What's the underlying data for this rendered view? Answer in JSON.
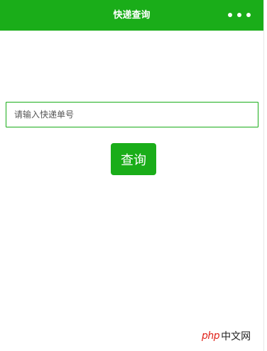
{
  "navbar": {
    "title": "快递查询",
    "background_color": "#1aad19",
    "menu_icon": "more-dots-icon"
  },
  "search": {
    "placeholder": "请输入快递单号",
    "value": "",
    "border_color": "#1aad19"
  },
  "query_button": {
    "label": "查询",
    "background_color": "#1aad19"
  },
  "watermark": {
    "php_text": "php",
    "cn_text": "中文网",
    "php_color": "#e0231a"
  }
}
